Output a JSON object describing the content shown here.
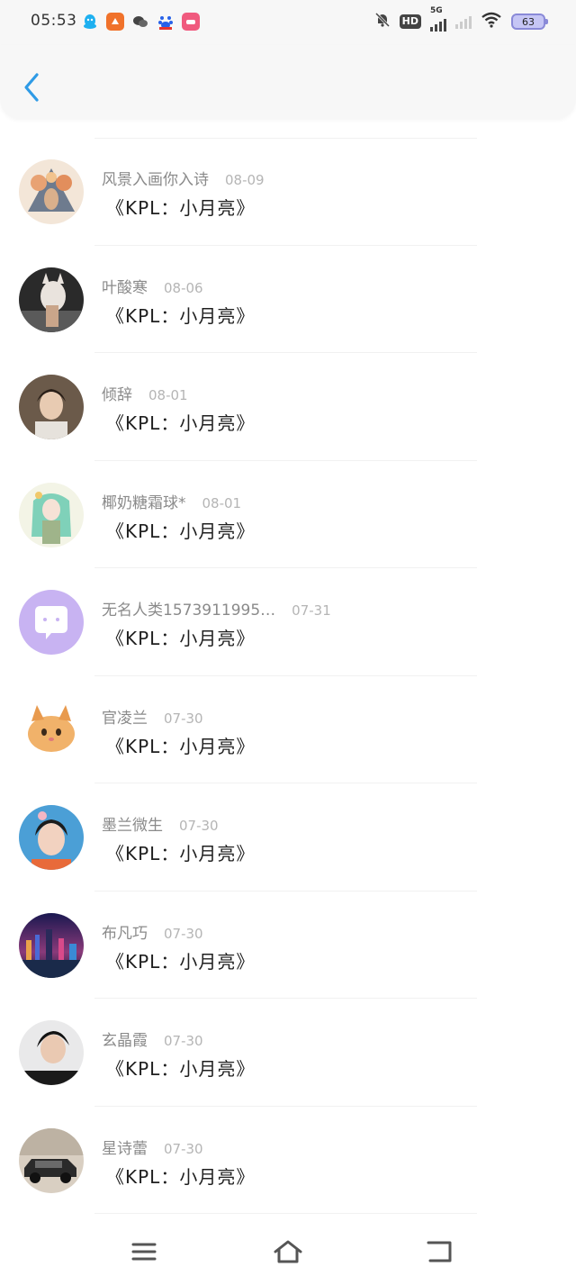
{
  "status_bar": {
    "time": "05:53",
    "notification_icons": [
      "qq-icon",
      "taobao-icon",
      "wechat-icon",
      "baidu-icon",
      "weibo-icon"
    ],
    "hd_label": "HD",
    "network": "5G",
    "battery": "63"
  },
  "header": {
    "back_icon": "chevron-left-icon"
  },
  "comments": [
    {
      "user": "风景入画你入诗",
      "date": "08-09",
      "text": "《KPL：小月亮》"
    },
    {
      "user": "叶酸寒",
      "date": "08-06",
      "text": "《KPL：小月亮》"
    },
    {
      "user": "倾辞",
      "date": "08-01",
      "text": "《KPL：小月亮》"
    },
    {
      "user": "椰奶糖霜球*",
      "date": "08-01",
      "text": "《KPL：小月亮》"
    },
    {
      "user": "无名人类1573911995…",
      "date": "07-31",
      "text": "《KPL：小月亮》"
    },
    {
      "user": "官凌兰",
      "date": "07-30",
      "text": "《KPL：小月亮》"
    },
    {
      "user": "墨兰微生",
      "date": "07-30",
      "text": "《KPL：小月亮》"
    },
    {
      "user": "布凡巧",
      "date": "07-30",
      "text": "《KPL：小月亮》"
    },
    {
      "user": "玄晶霞",
      "date": "07-30",
      "text": "《KPL：小月亮》"
    },
    {
      "user": "星诗蕾",
      "date": "07-30",
      "text": "《KPL：小月亮》"
    }
  ],
  "bottom_nav": {
    "menu_icon": "menu-icon",
    "home_icon": "home-icon",
    "back_icon": "back-icon"
  },
  "colors": {
    "accent": "#2f9be6",
    "username": "#8a8a8a",
    "date": "#b5b5b5",
    "divider": "#f1f1f1"
  }
}
